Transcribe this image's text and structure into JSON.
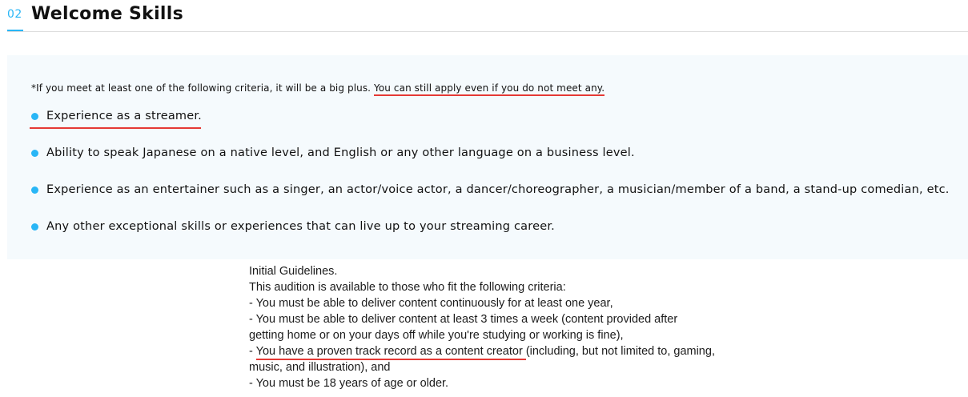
{
  "section": {
    "number": "02",
    "title": "Welcome Skills"
  },
  "panel": {
    "note_prefix": "*If you meet at least one of the following criteria, it will be a big plus. ",
    "note_emphasis": "You can still apply even if you do not meet any.",
    "criteria": [
      "Experience as a streamer.",
      "Ability to speak Japanese on a native level, and English or any other language on a business level.",
      "Experience as an entertainer such as a singer, an actor/voice actor, a dancer/choreographer, a musician/member of a band, a stand-up comedian, etc.",
      "Any other exceptional skills or experiences that can live up to your streaming career."
    ]
  },
  "guidelines": {
    "line1": "Initial Guidelines.",
    "line2": "This audition is available to those who fit the following criteria:",
    "line3": "- You must be able to deliver content continuously for at least one year,",
    "line4": "- You must be able to deliver content at least 3 times a week (content provided after",
    "line5": "getting home or on your days off while you're studying or working is fine),",
    "line6_prefix": "- ",
    "line6_emphasis": "You have a proven track record as a content creator ",
    "line6_suffix": "(including, but not limited to, gaming,",
    "line7": "music, and illustration), and",
    "line8": "- You must be 18 years of age or older."
  },
  "colors": {
    "accent": "#29b6f6",
    "highlight_underline": "#e53935",
    "panel_background": "#f5fafd"
  }
}
